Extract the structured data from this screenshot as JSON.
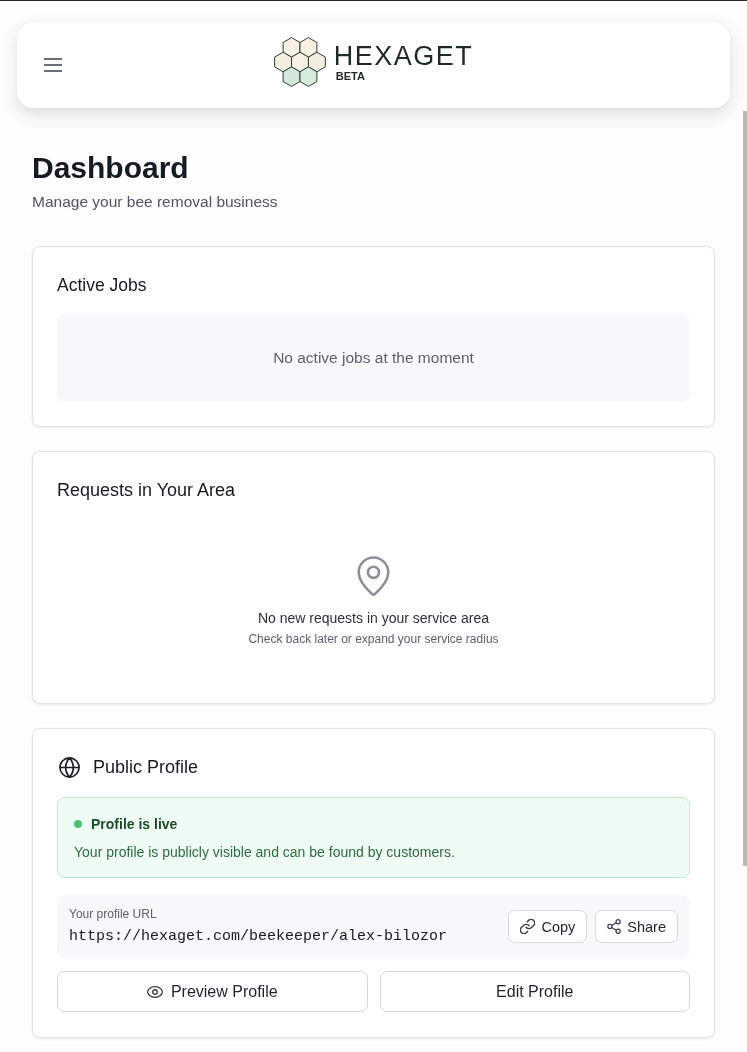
{
  "header": {
    "brand": "HEXAGET",
    "badge": "BETA"
  },
  "page": {
    "title": "Dashboard",
    "subtitle": "Manage your bee removal business"
  },
  "active_jobs": {
    "title": "Active Jobs",
    "empty_message": "No active jobs at the moment"
  },
  "requests": {
    "title": "Requests in Your Area",
    "empty_message": "No new requests in your service area",
    "empty_hint": "Check back later or expand your service radius"
  },
  "public_profile": {
    "title": "Public Profile",
    "status": {
      "live": true,
      "label": "Profile is live",
      "description": "Your profile is publicly visible and can be found by customers."
    },
    "url": {
      "label": "Your profile URL",
      "value": "https://hexaget.com/beekeeper/alex-bilozor"
    },
    "url_actions": [
      {
        "kind": "copy",
        "label": "Copy"
      },
      {
        "kind": "share",
        "label": "Share"
      }
    ],
    "actions": [
      {
        "kind": "preview",
        "label": "Preview Profile"
      },
      {
        "kind": "edit",
        "label": "Edit Profile"
      }
    ]
  }
}
